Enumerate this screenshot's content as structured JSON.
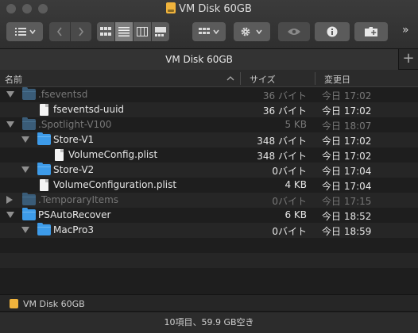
{
  "window": {
    "title": "VM Disk 60GB",
    "colors": {
      "background": "#1e1e1e",
      "folder": "#3d9be9",
      "disk_icon": "#f0b33c"
    }
  },
  "toolbar": {
    "group_icon": "group-list-icon",
    "back_icon": "chevron-left-icon",
    "forward_icon": "chevron-right-icon",
    "view_icons": [
      "icon-view-icon",
      "list-view-icon",
      "column-view-icon",
      "gallery-view-icon"
    ],
    "arrange_icon": "arrange-grid-icon",
    "action_icon": "gear-icon",
    "quicklook_icon": "eye-icon",
    "info_icon": "info-icon",
    "new_folder_icon": "new-folder-icon",
    "overflow_label": "»"
  },
  "tab": {
    "label": "VM Disk 60GB",
    "add_label": "+"
  },
  "columns": {
    "name": "名前",
    "size": "サイズ",
    "date": "変更日"
  },
  "rows": [
    {
      "name": ".fseventsd",
      "size": "36 バイト",
      "date": "今日 17:02",
      "type": "folder",
      "level": 0,
      "expanded": true,
      "hidden": true
    },
    {
      "name": "fseventsd-uuid",
      "size": "36 バイト",
      "date": "今日 17:02",
      "type": "file",
      "level": 1,
      "hidden": false
    },
    {
      "name": ".Spotlight-V100",
      "size": "5 KB",
      "date": "今日 18:07",
      "type": "folder",
      "level": 0,
      "expanded": true,
      "hidden": true
    },
    {
      "name": "Store-V1",
      "size": "348 バイト",
      "date": "今日 17:02",
      "type": "folder",
      "level": 1,
      "expanded": true,
      "hidden": false
    },
    {
      "name": "VolumeConfig.plist",
      "size": "348 バイト",
      "date": "今日 17:02",
      "type": "file",
      "level": 2,
      "hidden": false
    },
    {
      "name": "Store-V2",
      "size": "0バイト",
      "date": "今日 17:04",
      "type": "folder",
      "level": 1,
      "expanded": true,
      "hidden": false
    },
    {
      "name": "VolumeConfiguration.plist",
      "size": "4 KB",
      "date": "今日 17:04",
      "type": "file",
      "level": 1,
      "hidden": false
    },
    {
      "name": ".TemporaryItems",
      "size": "0バイト",
      "date": "今日 17:15",
      "type": "folder",
      "level": 0,
      "expanded": false,
      "hidden": true
    },
    {
      "name": "PSAutoRecover",
      "size": "6 KB",
      "date": "今日 18:52",
      "type": "folder",
      "level": 0,
      "expanded": true,
      "hidden": false
    },
    {
      "name": "MacPro3",
      "size": "0バイト",
      "date": "今日 18:59",
      "type": "folder",
      "level": 1,
      "expanded": true,
      "hidden": false
    }
  ],
  "pathbar": {
    "label": "VM Disk 60GB"
  },
  "status": {
    "text": "10項目、59.9 GB空き"
  }
}
